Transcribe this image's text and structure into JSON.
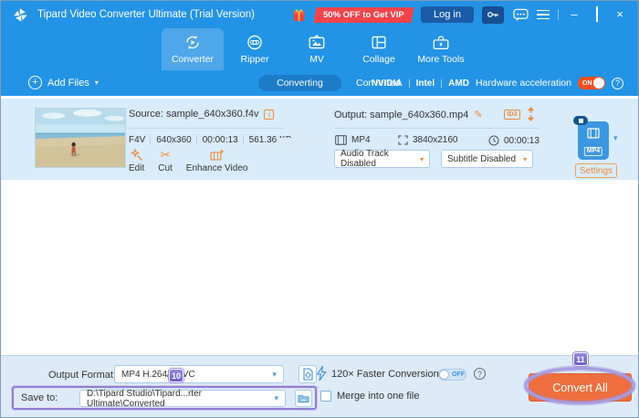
{
  "titlebar": {
    "title": "Tipard Video Converter Ultimate (Trial Version)",
    "vip_badge": "50% OFF to Get VIP",
    "login": "Log in"
  },
  "tabs": [
    {
      "label": "Converter"
    },
    {
      "label": "Ripper"
    },
    {
      "label": "MV"
    },
    {
      "label": "Collage"
    },
    {
      "label": "More Tools"
    }
  ],
  "toolbar": {
    "add_files": "Add Files",
    "converting": "Converting",
    "converted": "Converted",
    "brands": [
      "NVIDIA",
      "Intel",
      "AMD"
    ],
    "hw_label": "Hardware acceleration",
    "hw_state": "ON"
  },
  "file": {
    "source": "Source: sample_640x360.f4v",
    "meta": [
      "F4V",
      "640x360",
      "00:00:13",
      "561.36 KB"
    ],
    "actions": [
      "Edit",
      "Cut",
      "Enhance Video"
    ],
    "output": "Output: sample_640x360.mp4",
    "id3": "ID3",
    "format": "MP4",
    "resolution": "3840x2160",
    "duration": "00:00:13",
    "audio": "Audio Track Disabled",
    "subtitle": "Subtitle Disabled",
    "format_icon": "MP4",
    "settings": "Settings"
  },
  "bottom": {
    "output_format_label": "Output Format:",
    "output_format": "MP4 H.264/HEVC",
    "save_to_label": "Save to:",
    "save_to": "D:\\Tipard Studio\\Tipard...rter Ultimate\\Converted",
    "fast": "120× Faster Conversion",
    "fast_state": "OFF",
    "merge": "Merge into one file",
    "convert_all": "Convert All"
  },
  "annotations": {
    "step10": "10",
    "step11": "11"
  },
  "icons": {
    "caret_down": "▾",
    "plus": "+",
    "info": "i",
    "pencil": "✎",
    "scissors": "✂",
    "help": "?",
    "minimize": "–",
    "close": "×"
  },
  "colors": {
    "header_blue": "#2393e6",
    "accent_orange": "#ef8937",
    "convert_orange": "#ee6e3d",
    "annotation_purple": "#8d7fd6",
    "toggle_on": "#f4511e"
  }
}
